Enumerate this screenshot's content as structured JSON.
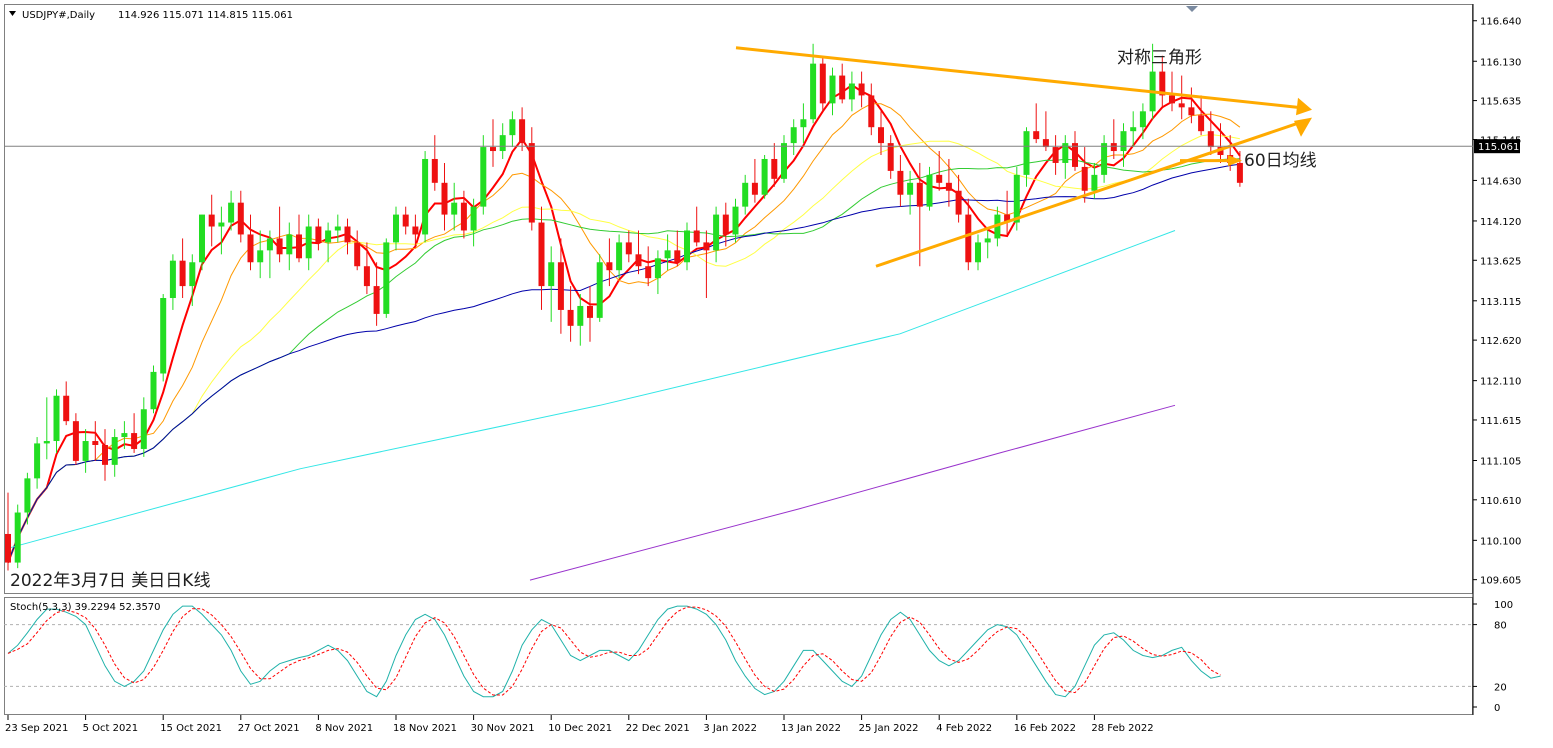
{
  "chart_data": {
    "type": "candlestick",
    "symbol_header": "USDJPY#,Daily",
    "ohlc_header": "114.926 115.071 114.815 115.061",
    "current_price_label": "115.061",
    "price_axis_ticks": [
      "116.640",
      "116.130",
      "115.635",
      "115.145",
      "115.061",
      "114.630",
      "114.120",
      "113.625",
      "113.115",
      "112.620",
      "112.110",
      "111.615",
      "111.105",
      "110.610",
      "110.100",
      "109.605"
    ],
    "price_axis_values": [
      116.64,
      116.13,
      115.635,
      115.145,
      115.061,
      114.63,
      114.12,
      113.625,
      113.115,
      112.62,
      112.11,
      111.615,
      111.105,
      110.61,
      110.1,
      109.605
    ],
    "ylim": [
      109.5,
      116.75
    ],
    "x_ticks": [
      "23 Sep 2021",
      "5 Oct 2021",
      "15 Oct 2021",
      "27 Oct 2021",
      "8 Nov 2021",
      "18 Nov 2021",
      "30 Nov 2021",
      "10 Dec 2021",
      "22 Dec 2021",
      "3 Jan 2022",
      "13 Jan 2022",
      "25 Jan 2022",
      "4 Feb 2022",
      "16 Feb 2022",
      "28 Feb 2022"
    ],
    "x_tick_index": [
      0,
      8,
      16,
      24,
      32,
      40,
      48,
      56,
      64,
      72,
      80,
      88,
      96,
      104,
      112
    ],
    "candles": [
      [
        110.18,
        110.7,
        109.72,
        109.82
      ],
      [
        109.82,
        110.55,
        109.75,
        110.45
      ],
      [
        110.45,
        110.95,
        110.3,
        110.88
      ],
      [
        110.88,
        111.4,
        110.75,
        111.32
      ],
      [
        111.32,
        111.9,
        111.12,
        111.35
      ],
      [
        111.35,
        112.0,
        111.2,
        111.92
      ],
      [
        111.92,
        112.1,
        111.55,
        111.6
      ],
      [
        111.6,
        111.7,
        111.05,
        111.1
      ],
      [
        111.1,
        111.5,
        110.95,
        111.35
      ],
      [
        111.35,
        111.6,
        111.1,
        111.3
      ],
      [
        111.3,
        111.5,
        110.85,
        111.05
      ],
      [
        111.05,
        111.5,
        110.9,
        111.4
      ],
      [
        111.4,
        111.6,
        111.25,
        111.45
      ],
      [
        111.45,
        111.7,
        111.2,
        111.25
      ],
      [
        111.25,
        111.9,
        111.15,
        111.75
      ],
      [
        111.75,
        112.3,
        111.7,
        112.22
      ],
      [
        112.2,
        113.2,
        112.1,
        113.15
      ],
      [
        113.15,
        113.7,
        113.0,
        113.62
      ],
      [
        113.62,
        113.9,
        113.15,
        113.3
      ],
      [
        113.3,
        113.7,
        113.05,
        113.6
      ],
      [
        113.6,
        114.2,
        113.5,
        114.2
      ],
      [
        114.2,
        114.45,
        113.8,
        114.05
      ],
      [
        114.05,
        114.3,
        113.7,
        114.1
      ],
      [
        114.1,
        114.5,
        114.0,
        114.35
      ],
      [
        114.35,
        114.5,
        113.85,
        113.95
      ],
      [
        113.95,
        114.2,
        113.5,
        113.6
      ],
      [
        113.6,
        114.0,
        113.4,
        113.75
      ],
      [
        113.75,
        114.0,
        113.4,
        113.9
      ],
      [
        113.9,
        114.3,
        113.6,
        113.7
      ],
      [
        113.7,
        114.1,
        113.5,
        113.95
      ],
      [
        113.95,
        114.2,
        113.6,
        113.65
      ],
      [
        113.65,
        114.2,
        113.5,
        114.05
      ],
      [
        114.05,
        114.15,
        113.75,
        113.85
      ],
      [
        113.85,
        114.1,
        113.6,
        114.0
      ],
      [
        114.0,
        114.2,
        113.85,
        114.05
      ],
      [
        114.05,
        114.15,
        113.7,
        113.85
      ],
      [
        113.85,
        114.0,
        113.5,
        113.55
      ],
      [
        113.55,
        113.85,
        113.2,
        113.3
      ],
      [
        113.3,
        113.6,
        112.8,
        112.95
      ],
      [
        112.95,
        113.9,
        112.9,
        113.85
      ],
      [
        113.85,
        114.3,
        113.75,
        114.2
      ],
      [
        114.2,
        114.3,
        113.95,
        114.05
      ],
      [
        114.05,
        114.2,
        113.8,
        113.95
      ],
      [
        113.95,
        115.0,
        113.85,
        114.9
      ],
      [
        114.9,
        115.2,
        114.5,
        114.6
      ],
      [
        114.6,
        114.85,
        114.0,
        114.2
      ],
      [
        114.2,
        114.6,
        114.0,
        114.35
      ],
      [
        114.35,
        114.5,
        113.9,
        114.0
      ],
      [
        114.0,
        114.4,
        113.8,
        114.3
      ],
      [
        114.3,
        115.2,
        114.2,
        115.05
      ],
      [
        115.05,
        115.4,
        114.8,
        115.0
      ],
      [
        115.0,
        115.35,
        114.9,
        115.2
      ],
      [
        115.2,
        115.5,
        115.05,
        115.4
      ],
      [
        115.4,
        115.55,
        115.0,
        115.1
      ],
      [
        115.1,
        115.3,
        114.0,
        114.1
      ],
      [
        114.1,
        114.3,
        113.0,
        113.3
      ],
      [
        113.3,
        113.8,
        112.85,
        113.6
      ],
      [
        113.6,
        113.9,
        112.7,
        113.0
      ],
      [
        113.0,
        113.3,
        112.6,
        112.8
      ],
      [
        112.8,
        113.2,
        112.55,
        113.05
      ],
      [
        113.05,
        113.3,
        112.6,
        112.9
      ],
      [
        112.9,
        113.7,
        112.85,
        113.6
      ],
      [
        113.6,
        113.9,
        113.3,
        113.5
      ],
      [
        113.5,
        113.95,
        113.4,
        113.85
      ],
      [
        113.85,
        114.0,
        113.6,
        113.7
      ],
      [
        113.7,
        114.0,
        113.45,
        113.55
      ],
      [
        113.55,
        113.8,
        113.3,
        113.4
      ],
      [
        113.4,
        113.75,
        113.2,
        113.65
      ],
      [
        113.65,
        113.95,
        113.5,
        113.75
      ],
      [
        113.75,
        114.0,
        113.55,
        113.6
      ],
      [
        113.6,
        114.1,
        113.5,
        114.0
      ],
      [
        114.0,
        114.3,
        113.8,
        113.85
      ],
      [
        113.85,
        114.0,
        113.15,
        113.75
      ],
      [
        113.75,
        114.3,
        113.6,
        114.2
      ],
      [
        114.2,
        114.35,
        113.8,
        113.95
      ],
      [
        113.95,
        114.4,
        113.85,
        114.3
      ],
      [
        114.3,
        114.7,
        114.2,
        114.6
      ],
      [
        114.6,
        114.9,
        114.35,
        114.45
      ],
      [
        114.45,
        114.95,
        114.4,
        114.9
      ],
      [
        114.9,
        115.1,
        114.55,
        114.65
      ],
      [
        114.65,
        115.2,
        114.6,
        115.1
      ],
      [
        115.1,
        115.4,
        114.95,
        115.3
      ],
      [
        115.3,
        115.6,
        115.1,
        115.4
      ],
      [
        115.4,
        116.35,
        115.35,
        116.1
      ],
      [
        116.1,
        116.2,
        115.5,
        115.6
      ],
      [
        115.6,
        116.05,
        115.45,
        115.95
      ],
      [
        115.95,
        116.1,
        115.6,
        115.65
      ],
      [
        115.65,
        116.0,
        115.5,
        115.85
      ],
      [
        115.85,
        116.0,
        115.55,
        115.7
      ],
      [
        115.7,
        115.85,
        115.2,
        115.3
      ],
      [
        115.3,
        115.5,
        114.95,
        115.1
      ],
      [
        115.1,
        115.2,
        114.65,
        114.75
      ],
      [
        114.75,
        114.95,
        114.3,
        114.45
      ],
      [
        114.45,
        114.75,
        114.2,
        114.6
      ],
      [
        114.6,
        114.85,
        113.55,
        114.3
      ],
      [
        114.3,
        114.8,
        114.25,
        114.7
      ],
      [
        114.7,
        115.0,
        114.5,
        114.6
      ],
      [
        114.6,
        114.9,
        114.3,
        114.5
      ],
      [
        114.5,
        114.7,
        114.1,
        114.2
      ],
      [
        114.2,
        114.4,
        113.5,
        113.6
      ],
      [
        113.6,
        113.95,
        113.5,
        113.85
      ],
      [
        113.85,
        114.0,
        113.65,
        113.9
      ],
      [
        113.9,
        114.3,
        113.8,
        114.2
      ],
      [
        114.2,
        114.5,
        113.95,
        114.1
      ],
      [
        114.1,
        114.8,
        114.0,
        114.7
      ],
      [
        114.7,
        115.3,
        114.55,
        115.25
      ],
      [
        115.25,
        115.6,
        115.1,
        115.15
      ],
      [
        115.15,
        115.5,
        115.0,
        115.05
      ],
      [
        115.05,
        115.2,
        114.7,
        114.85
      ],
      [
        114.85,
        115.2,
        114.65,
        115.1
      ],
      [
        115.1,
        115.25,
        114.75,
        114.8
      ],
      [
        114.8,
        115.05,
        114.35,
        114.5
      ],
      [
        114.5,
        114.85,
        114.4,
        114.7
      ],
      [
        114.7,
        115.2,
        114.6,
        115.1
      ],
      [
        115.1,
        115.4,
        114.9,
        115.0
      ],
      [
        115.0,
        115.35,
        114.8,
        115.25
      ],
      [
        115.25,
        115.5,
        115.05,
        115.3
      ],
      [
        115.3,
        115.6,
        115.15,
        115.5
      ],
      [
        115.5,
        116.35,
        115.4,
        116.0
      ],
      [
        116.0,
        116.2,
        115.55,
        115.7
      ],
      [
        115.7,
        116.0,
        115.5,
        115.6
      ],
      [
        115.6,
        115.95,
        115.4,
        115.55
      ],
      [
        115.55,
        115.8,
        115.35,
        115.45
      ],
      [
        115.45,
        115.7,
        115.2,
        115.25
      ],
      [
        115.25,
        115.5,
        114.95,
        115.05
      ],
      [
        115.05,
        115.35,
        114.85,
        114.95
      ],
      [
        114.95,
        115.2,
        114.75,
        114.85
      ],
      [
        114.85,
        115.0,
        114.55,
        114.6
      ]
    ],
    "ma_colors": [
      "#ff0000",
      "#ff9900",
      "#ffff44",
      "#33cc33",
      "#0000aa",
      "#33e6e6",
      "#9933cc"
    ],
    "ma_period_label": "60日均线",
    "annotation_triangle": "对称三角形",
    "annotation_date": "2022年3月7日 美日日K线",
    "stoch_header": "Stoch(5,3,3) 39.2294 52.3570",
    "stoch_ticks": [
      "100",
      "80",
      "20",
      "0"
    ],
    "stoch_levels": [
      100,
      80,
      20,
      0
    ],
    "stoch_k": [
      52,
      60,
      72,
      85,
      95,
      95,
      92,
      88,
      80,
      60,
      40,
      25,
      20,
      25,
      35,
      55,
      75,
      90,
      98,
      98,
      90,
      80,
      70,
      55,
      35,
      22,
      25,
      35,
      42,
      45,
      48,
      50,
      55,
      60,
      55,
      45,
      30,
      15,
      10,
      25,
      50,
      70,
      85,
      90,
      85,
      70,
      50,
      30,
      15,
      10,
      10,
      15,
      35,
      60,
      75,
      85,
      80,
      65,
      50,
      45,
      50,
      55,
      55,
      50,
      45,
      55,
      70,
      85,
      95,
      98,
      98,
      95,
      90,
      80,
      65,
      45,
      30,
      18,
      12,
      15,
      25,
      40,
      55,
      55,
      45,
      35,
      25,
      20,
      30,
      50,
      70,
      85,
      92,
      85,
      70,
      55,
      45,
      40,
      45,
      55,
      65,
      75,
      80,
      78,
      70,
      55,
      40,
      25,
      12,
      10,
      20,
      40,
      60,
      70,
      72,
      65,
      55,
      50,
      48,
      50,
      55,
      58,
      45,
      35,
      28,
      30
    ]
  },
  "colors": {
    "bull": "#22dd22",
    "bear": "#ee1111",
    "triangle": "#ffaa00",
    "axis": "#000000",
    "price_line": "#808080",
    "grid_border": "#808080"
  }
}
